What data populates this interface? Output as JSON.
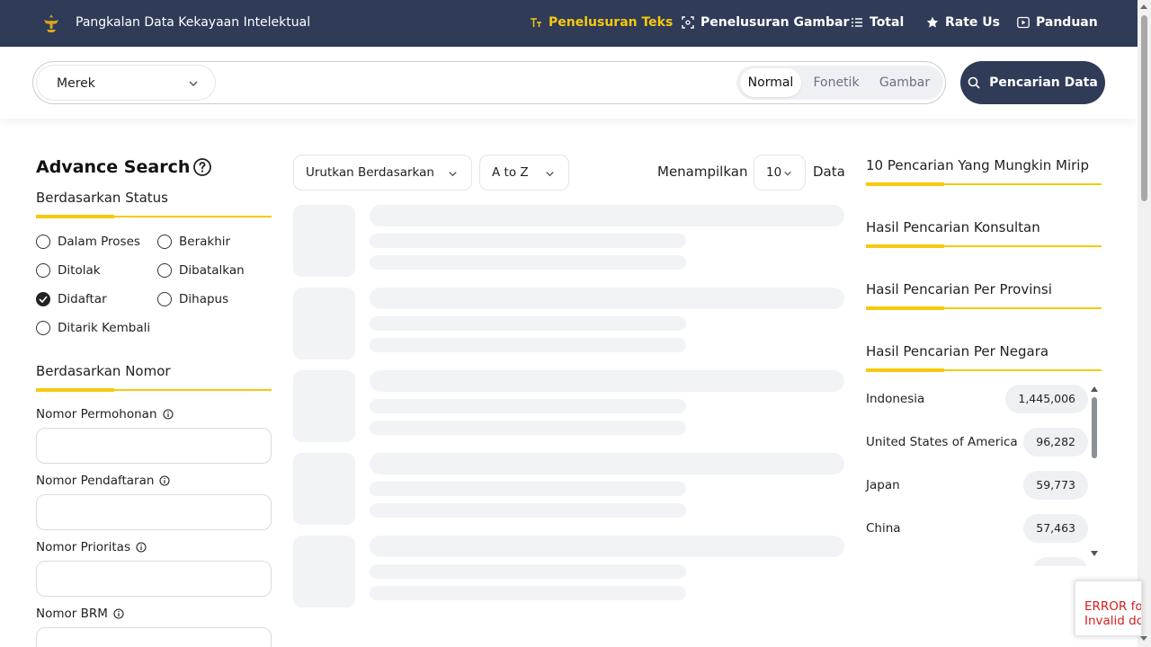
{
  "header": {
    "app_title": "Pangkalan Data Kekayaan Intelektual",
    "nav": [
      {
        "label": "Penelusuran Teks",
        "icon": "text-size-icon",
        "active": true
      },
      {
        "label": "Penelusuran Gambar",
        "icon": "image-scan-icon",
        "active": false
      },
      {
        "label": "Total",
        "icon": "list-icon",
        "active": false
      },
      {
        "label": "Rate Us",
        "icon": "star-icon",
        "active": false
      },
      {
        "label": "Panduan",
        "icon": "play-icon",
        "active": false
      }
    ]
  },
  "search": {
    "type_selected": "Merek",
    "query_value": "",
    "modes": [
      "Normal",
      "Fonetik",
      "Gambar"
    ],
    "active_mode": "Normal",
    "button_label": "Pencarian Data"
  },
  "advance": {
    "title": "Advance Search",
    "status_title": "Berdasarkan Status",
    "statuses": [
      {
        "label": "Dalam Proses",
        "checked": false
      },
      {
        "label": "Berakhir",
        "checked": false
      },
      {
        "label": "Ditolak",
        "checked": false
      },
      {
        "label": "Dibatalkan",
        "checked": false
      },
      {
        "label": "Didaftar",
        "checked": true
      },
      {
        "label": "Dihapus",
        "checked": false
      },
      {
        "label": "Ditarik Kembali",
        "checked": false
      }
    ],
    "number_title": "Berdasarkan Nomor",
    "fields": [
      {
        "label": "Nomor Permohonan",
        "value": ""
      },
      {
        "label": "Nomor Pendaftaran",
        "value": ""
      },
      {
        "label": "Nomor Prioritas",
        "value": ""
      },
      {
        "label": "Nomor BRM",
        "value": ""
      }
    ]
  },
  "results": {
    "sort_label": "Urutkan Berdasarkan",
    "order_label": "A to Z",
    "show_label": "Menampilkan",
    "per_page": "10",
    "data_label": "Data"
  },
  "right": {
    "sections": [
      "10 Pencarian Yang Mungkin Mirip",
      "Hasil Pencarian Konsultan",
      "Hasil Pencarian Per Provinsi",
      "Hasil Pencarian Per Negara"
    ],
    "countries": [
      {
        "name": "Indonesia",
        "count": "1,445,006"
      },
      {
        "name": "United States of America",
        "count": "96,282"
      },
      {
        "name": "Japan",
        "count": "59,773"
      },
      {
        "name": "China",
        "count": "57,463"
      }
    ]
  },
  "error": {
    "line1": "ERROR fo",
    "line2": "Invalid do"
  },
  "colors": {
    "navy": "#2f3b57",
    "accent_yellow": "#f6c90e",
    "error_red": "#d21f1f"
  }
}
